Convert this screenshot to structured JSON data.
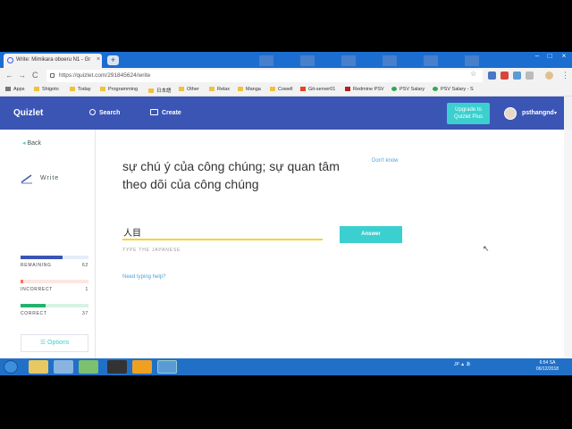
{
  "browser": {
    "tab_title": "Write: Mimikara oboeru N1 - Gr",
    "tab_close": "×",
    "new_tab": "+",
    "url": "https://quizlet.com/291845624/write",
    "back": "←",
    "forward": "→",
    "reload": "C",
    "menu": "⋮",
    "bookmarks": [
      {
        "label": "Apps"
      },
      {
        "label": "Shigoto"
      },
      {
        "label": "Today"
      },
      {
        "label": "Programming"
      },
      {
        "label": "日本語"
      },
      {
        "label": "Other"
      },
      {
        "label": "Relax"
      },
      {
        "label": "Manga"
      },
      {
        "label": "Cowell"
      },
      {
        "label": "Git-server01"
      },
      {
        "label": "Redmine PSV"
      },
      {
        "label": "PSV Salary"
      },
      {
        "label": "PSV Salary - S"
      }
    ]
  },
  "header": {
    "logo": "Quizlet",
    "search_label": "Search",
    "create_label": "Create",
    "upgrade_line1": "Upgrade to",
    "upgrade_line2": "Quizlet Plus",
    "username": "psthangnd",
    "caret": "▾"
  },
  "sidebar": {
    "back_label": "Back",
    "back_arrow": "◂",
    "mode_label": "Write",
    "remaining_label": "REMAINING",
    "remaining_value": "62",
    "incorrect_label": "INCORRECT",
    "incorrect_value": "1",
    "correct_label": "CORRECT",
    "correct_value": "37",
    "remaining_fraction": 0.62,
    "incorrect_fraction": 0.01,
    "correct_fraction": 0.37,
    "options_label": "Options",
    "options_icon": "☰"
  },
  "main": {
    "prompt": "sự chú ý của công chúng; sự quan tâm theo dõi của công chúng",
    "dont_know": "Don't know",
    "answer_value": "人目",
    "type_label": "TYPE THE JAPANESE",
    "answer_button": "Answer",
    "typing_help": "Need typing help?"
  },
  "taskbar": {
    "tray_text": "JP ▲ あ",
    "time": "6:54 SA",
    "date": "06/12/2018"
  },
  "colors": {
    "quizlet_blue": "#3b55b5",
    "teal": "#3ccfcf",
    "yellow_underline": "#f6d33c",
    "remaining": "#3b55b5",
    "incorrect": "#ff725b",
    "correct": "#23b26d"
  }
}
